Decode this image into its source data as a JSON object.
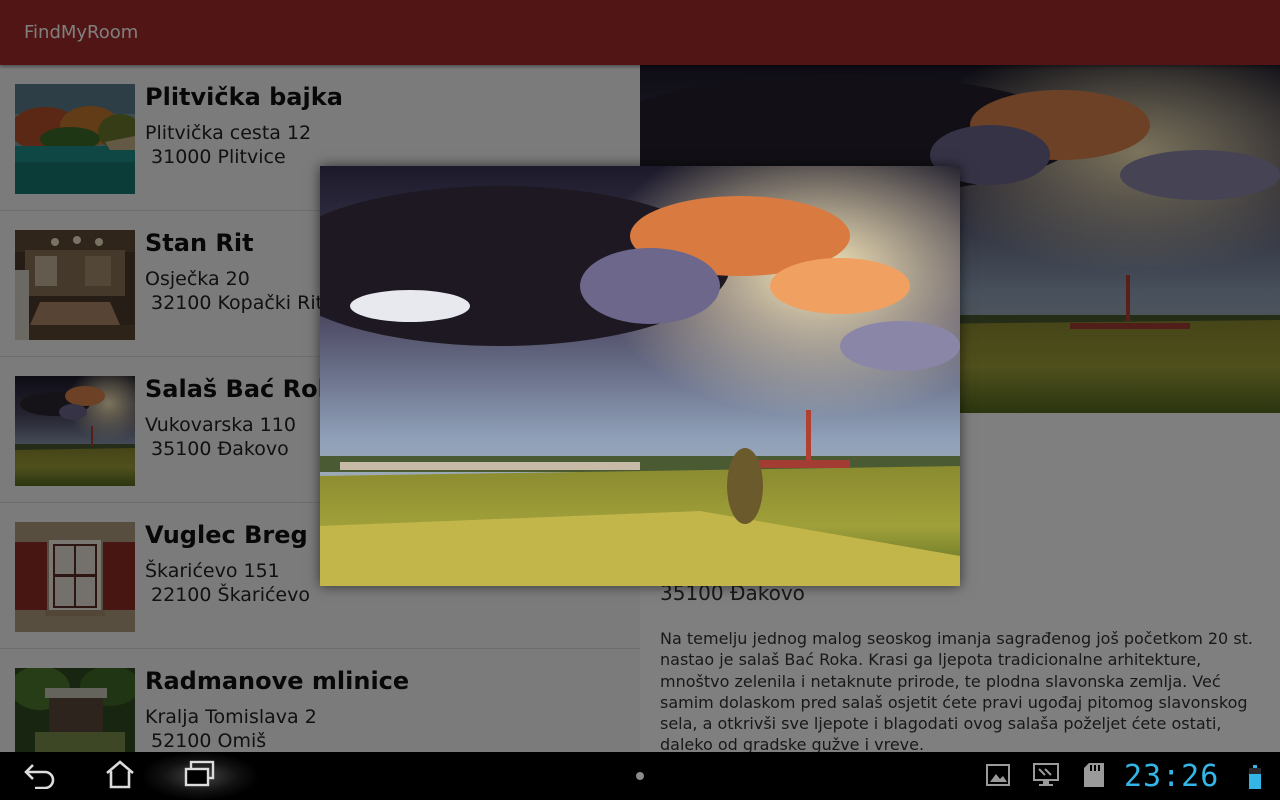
{
  "app": {
    "title": "FindMyRoom"
  },
  "rooms": [
    {
      "name": "Plitvička bajka",
      "street": "Plitvička cesta 12",
      "city": " 31000 Plitvice"
    },
    {
      "name": "Stan Rit",
      "street": "Osječka 20",
      "city": " 32100 Kopački Rit"
    },
    {
      "name": "Salaš Bać Roka",
      "street": "Vukovarska 110",
      "city": " 35100 Đakovo"
    },
    {
      "name": "Vuglec Breg",
      "street": "Škarićevo 151",
      "city": " 22100 Škarićevo"
    },
    {
      "name": "Radmanove mlinice",
      "street": "Kralja Tomislava 2",
      "city": " 52100 Omiš"
    }
  ],
  "detail": {
    "postal": "35100 Đakovo",
    "description": "Na temelju jednog malog seoskog imanja sagrađenog još početkom 20 st. nastao je salaš Bać Roka. Krasi ga ljepota tradicionalne arhitekture, mnoštvo zelenila i netaknute prirode, te plodna slavonska zemlja. Već samim dolaskom pred salaš osjetit ćete pravi ugođaj pitomog slavonskog sela, a otkrivši sve ljepote i blagodati ovog salaša poželjet ćete ostati, daleko od gradske gužve i vreve."
  },
  "system_bar": {
    "clock": "23:26",
    "clock_color": "#33b5e5",
    "icons": [
      "back-icon",
      "home-icon",
      "recent-apps-icon",
      "gallery-icon",
      "screenshot-icon",
      "sd-card-icon",
      "battery-icon"
    ]
  },
  "colors": {
    "action_bar": "#a52a2a",
    "clock": "#33b5e5",
    "battery": "#33b5e5"
  }
}
